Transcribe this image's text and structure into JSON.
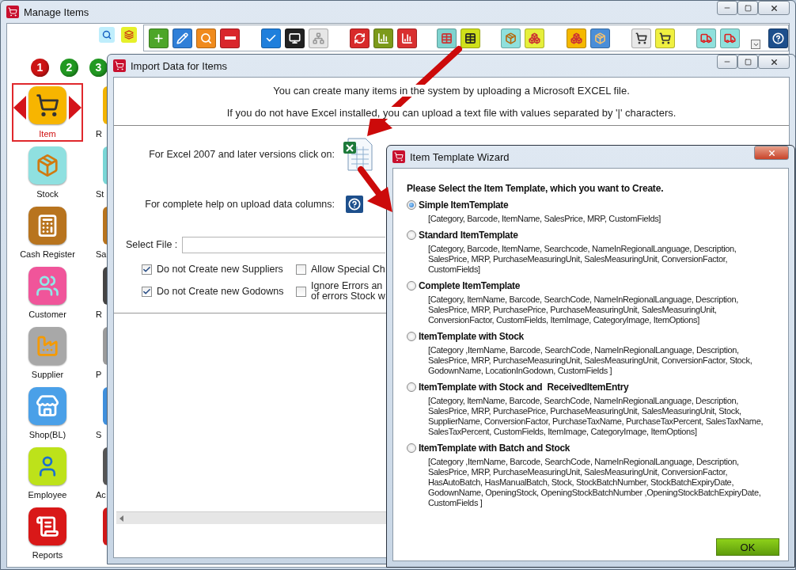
{
  "main_window": {
    "title": "Manage Items"
  },
  "steps": [
    {
      "label": "1",
      "color": "#cc1414"
    },
    {
      "label": "2",
      "color": "#229922"
    },
    {
      "label": "3",
      "color": "#229922"
    }
  ],
  "sidebar": {
    "items": [
      {
        "label": "Item",
        "selected": true
      },
      {
        "label": "Stock",
        "selected": false
      },
      {
        "label": "Cash Register",
        "selected": false
      },
      {
        "label": "Customer",
        "selected": false
      },
      {
        "label": "Supplier",
        "selected": false
      },
      {
        "label": "Shop(BL)",
        "selected": false
      },
      {
        "label": "Employee",
        "selected": false
      },
      {
        "label": "Reports",
        "selected": false
      }
    ],
    "second_column": [
      "R",
      "St",
      "Sa",
      "R",
      "P",
      "S",
      "Ac"
    ]
  },
  "import_window": {
    "title": "Import Data for Items",
    "intro": [
      "You can create many items in the system by uploading a Microsoft EXCEL file.",
      "If you do not have Excel installed, you can upload a text file with values separated by '|' characters."
    ],
    "excel_prompt": "For Excel 2007 and later versions click on:",
    "help_prompt": "For complete help on upload data columns:",
    "select_file": {
      "label": "Select File :"
    },
    "options": [
      {
        "label": "Do not Create new Suppliers",
        "checked": true
      },
      {
        "label": "Allow Special Ch",
        "checked": false
      },
      {
        "label": "Do not Create new Godowns",
        "checked": true
      },
      {
        "label": "Ignore Errors an\nof errors Stock w",
        "checked": false
      }
    ]
  },
  "wizard": {
    "title": "Item Template Wizard",
    "heading": "Please Select the Item Template, which you want to Create.",
    "templates": [
      {
        "name": "Simple ItemTemplate",
        "fields": "[Category, Barcode, ItemName, SalesPrice, MRP, CustomFields]",
        "selected": true
      },
      {
        "name": "Standard ItemTemplate",
        "fields": "[Category, Barcode, ItemName, Searchcode, NameInRegionalLanguage, Description, SalesPrice, MRP, PurchaseMeasuringUnit, SalesMeasuringUnit, ConversionFactor, CustomFields]",
        "selected": false
      },
      {
        "name": "Complete ItemTemplate",
        "fields": "[Category, ItemName, Barcode, SearchCode, NameInRegionalLanguage, Description, SalesPrice, MRP, PurchasePrice, PurchaseMeasuringUnit, SalesMeasuringUnit, ConversionFactor, CustomFields, ItemImage, CategoryImage, ItemOptions]",
        "selected": false
      },
      {
        "name": "ItemTemplate with Stock",
        "fields": "[Category ,ItemName, Barcode, SearchCode, NameInRegionalLanguage, Description, SalesPrice, MRP, PurchaseMeasuringUnit, SalesMeasuringUnit, ConversionFactor, Stock, GodownName, LocationInGodown, CustomFields ]",
        "selected": false
      },
      {
        "name": "ItemTemplate with Stock and  ReceivedItemEntry",
        "fields": "[Category, ItemName, Barcode, SearchCode, NameInRegionalLanguage, Description, SalesPrice, MRP, PurchasePrice, PurchaseMeasuringUnit, SalesMeasuringUnit, Stock, SupplierName, ConversionFactor, PurchaseTaxName, PurchaseTaxPercent, SalesTaxName, SalesTaxPercent, CustomFields, ItemImage, CategoryImage, ItemOptions]",
        "selected": false
      },
      {
        "name": "ItemTemplate with Batch and Stock",
        "fields": "[Category ,ItemName, Barcode, SearchCode, NameInRegionalLanguage, Description, SalesPrice, MRP, PurchaseMeasuringUnit, SalesMeasuringUnit, ConversionFactor, HasAutoBatch, HasManualBatch, Stock, StockBatchNumber, StockBatchExpiryDate, GodownName, OpeningStock, OpeningStockBatchNumber ,OpeningStockBatchExpiryDate, CustomFields ]",
        "selected": false
      }
    ],
    "ok_button": "OK"
  }
}
